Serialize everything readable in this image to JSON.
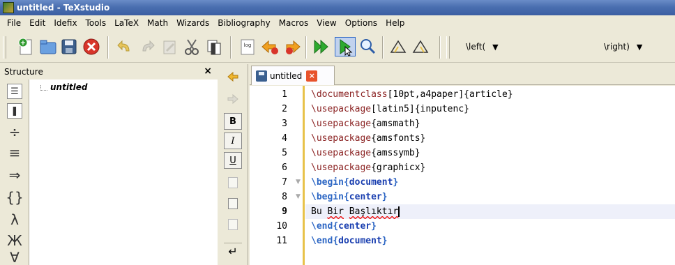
{
  "window": {
    "title": "untitled - TeXstudio"
  },
  "menu": [
    "File",
    "Edit",
    "Idefix",
    "Tools",
    "LaTeX",
    "Math",
    "Wizards",
    "Bibliography",
    "Macros",
    "View",
    "Options",
    "Help"
  ],
  "toolbar": {
    "buttons": [
      "new-file-icon",
      "open-file-icon",
      "save-icon",
      "close-icon",
      "undo-icon",
      "redo-icon",
      "paste-icon",
      "cut-icon",
      "copy-icon",
      "log-icon",
      "previous-error-icon",
      "next-error-icon",
      "quick-build-icon",
      "compile-icon",
      "view-icon",
      "triangle-up-icon",
      "triangle-down-icon"
    ],
    "left_combo": "\\left(",
    "right_combo": "\\right)"
  },
  "structure": {
    "title": "Structure",
    "close": "×",
    "tree_root": "untitled",
    "symbols": [
      "list-icon",
      "bookmark-icon",
      "÷",
      "≡",
      "⇒",
      "{}",
      "λ",
      "Ж",
      "∀"
    ]
  },
  "format_bar": {
    "bold": "B",
    "italic": "I",
    "underline": "U",
    "newline": "↵"
  },
  "tabs": [
    {
      "label": "untitled",
      "close": "×"
    }
  ],
  "editor": {
    "current_line": 9,
    "lines": [
      {
        "num": "1",
        "cmd": "\\documentclass",
        "rest": "[10pt,a4paper]{article}"
      },
      {
        "num": "2",
        "cmd": "\\usepackage",
        "rest": "[latin5]{inputenc}"
      },
      {
        "num": "3",
        "cmd": "\\usepackage",
        "rest": "{amsmath}"
      },
      {
        "num": "4",
        "cmd": "\\usepackage",
        "rest": "{amsfonts}"
      },
      {
        "num": "5",
        "cmd": "\\usepackage",
        "rest": "{amssymb}"
      },
      {
        "num": "6",
        "cmd": "\\usepackage",
        "rest": "{graphicx}"
      },
      {
        "num": "7",
        "cmd": "\\begin",
        "env": "document"
      },
      {
        "num": "8",
        "cmd": "\\begin",
        "env": "center"
      },
      {
        "num": "9",
        "text_a": "Bu ",
        "text_b": "Bir",
        "text_c": " ",
        "text_d": "Başlıktır"
      },
      {
        "num": "10",
        "cmd": "\\end",
        "env": "center"
      },
      {
        "num": "11",
        "cmd": "\\end",
        "env": "document"
      }
    ]
  },
  "colors": {
    "titlebar": "#3b5ea2",
    "command": "#8b2323",
    "environment": "#2c66c4",
    "gutter_bar": "#e8c24a"
  }
}
